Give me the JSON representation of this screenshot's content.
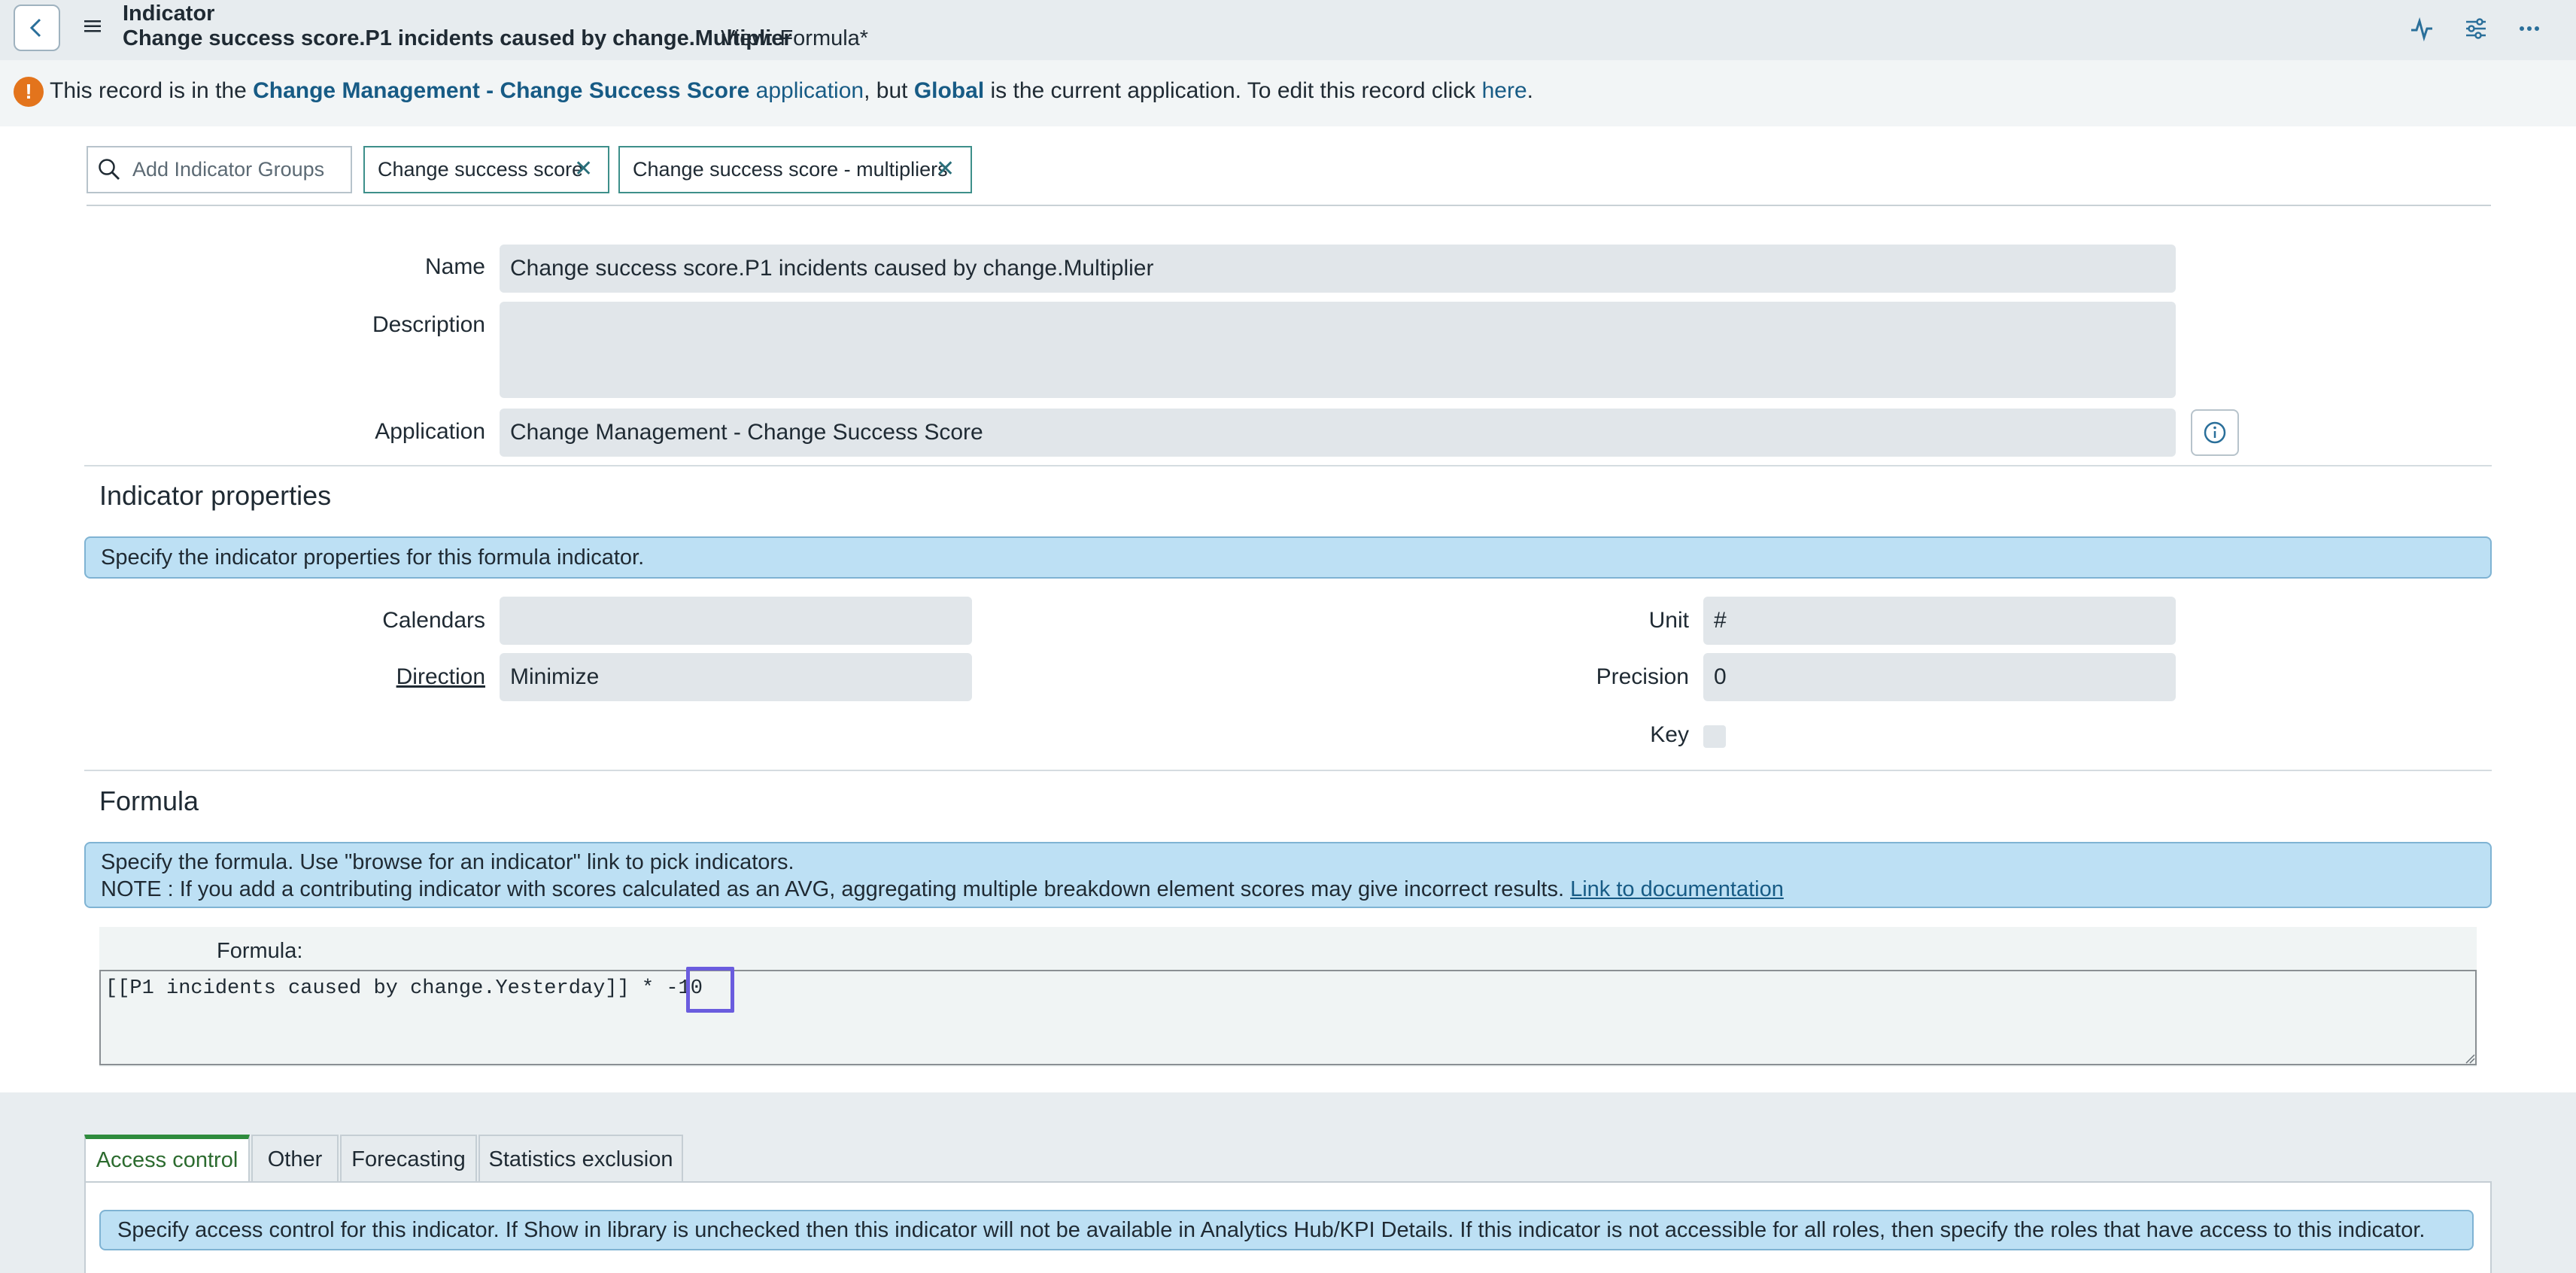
{
  "header": {
    "title": "Indicator",
    "subtitle": "Change success score.P1 incidents caused by change.Multiplier",
    "view": "View: Formula*"
  },
  "banner": {
    "t1": "This record is in the ",
    "app_name": "Change Management - Change Success Score",
    "t2": " ",
    "app_word": "application",
    "t3": ", but ",
    "current_app": "Global",
    "t4": " is the current application. To edit this record click ",
    "here": "here",
    "t5": "."
  },
  "groups": {
    "placeholder": "Add Indicator Groups",
    "pills": [
      "Change success score",
      "Change success score - multipliers"
    ]
  },
  "form": {
    "name_label": "Name",
    "name_value": "Change success score.P1 incidents caused by change.Multiplier",
    "description_label": "Description",
    "description_value": "",
    "application_label": "Application",
    "application_value": "Change Management - Change Success Score"
  },
  "properties": {
    "section_title": "Indicator properties",
    "info": "Specify the indicator properties for this formula indicator.",
    "calendars_label": "Calendars",
    "calendars_value": "",
    "direction_label": "Direction",
    "direction_value": "Minimize",
    "unit_label": "Unit",
    "unit_value": "#",
    "precision_label": "Precision",
    "precision_value": "0",
    "key_label": "Key"
  },
  "formula": {
    "section_title": "Formula",
    "info_line1": "Specify the formula. Use \"browse for an indicator\" link to pick indicators.",
    "info_line2": "NOTE : If you add a contributing indicator with scores calculated as an AVG, aggregating multiple breakdown element scores may give incorrect results. ",
    "doc_link": "Link to documentation",
    "label": "Formula:",
    "value": "[[P1 incidents caused by change.Yesterday]] * -10"
  },
  "tabs": [
    "Access control",
    "Other",
    "Forecasting",
    "Statistics exclusion"
  ],
  "access_info": "Specify access control for this indicator. If Show in library is unchecked then this indicator will not be available in Analytics Hub/KPI Details. If this indicator is not accessible for all roles, then specify the roles that have access to this indicator.",
  "colors": {
    "header_bg": "#e7ecef",
    "link": "#175b85",
    "info_bg": "#bde0f4",
    "warning": "#e3741c",
    "active_tab": "#2e8b3d",
    "highlight": "#6a5cde"
  }
}
